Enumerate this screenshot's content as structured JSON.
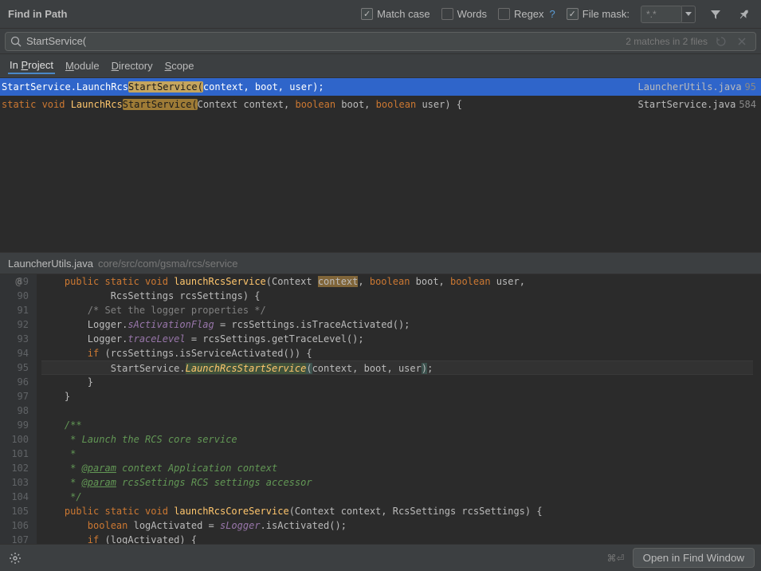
{
  "header": {
    "title": "Find in Path",
    "match_case_label": "Match case",
    "match_case_checked": true,
    "words_label": "Words",
    "words_checked": false,
    "regex_label": "Regex",
    "regex_checked": false,
    "regex_help": "?",
    "file_mask_label": "File mask:",
    "file_mask_checked": true,
    "file_mask_value": "*.*"
  },
  "search": {
    "value": "StartService(",
    "status": "2 matches in 2 files"
  },
  "scope_tabs": {
    "in_project": "In Project",
    "module": "Module",
    "directory": "Directory",
    "scope": "Scope"
  },
  "results": [
    {
      "prefix": "StartService.LaunchRcs",
      "highlight": "StartService(",
      "suffix": "context, boot, user);",
      "file": "LauncherUtils.java",
      "line": "95",
      "selected": true
    },
    {
      "mod": "static void ",
      "prefix": "LaunchRcs",
      "highlight": "StartService(",
      "sig_part1": "Context context, ",
      "kw1": "boolean",
      "sig_part2": " boot, ",
      "kw2": "boolean",
      "sig_part3": " user) {",
      "file": "StartService.java",
      "line": "584",
      "selected": false
    }
  ],
  "preview": {
    "filename": "LauncherUtils.java",
    "path": "core/src/com/gsma/rcs/service",
    "gutter_mark": "@",
    "lines": [
      {
        "n": "89",
        "html": "    <span class='c-keyword'>public static void </span><span class='c-method'>launchRcsService</span>(Context <span class='c-hl-bg'>context</span>, <span class='c-keyword'>boolean</span> boot, <span class='c-keyword'>boolean</span> user,"
      },
      {
        "n": "90",
        "html": "            RcsSettings rcsSettings) {"
      },
      {
        "n": "91",
        "html": "        <span class='c-comment'>/* Set the logger properties */</span>"
      },
      {
        "n": "92",
        "html": "        Logger.<span class='c-field'>sActivationFlag</span> = rcsSettings.isTraceActivated();"
      },
      {
        "n": "93",
        "html": "        Logger.<span class='c-field'>traceLevel</span> = rcsSettings.getTraceLevel();"
      },
      {
        "n": "94",
        "html": "        <span class='c-keyword'>if</span> (rcsSettings.isServiceActivated()) {"
      },
      {
        "n": "95",
        "html": "            StartService.<span class='c-hl-method'>LaunchRcsStartService</span><span class='c-paren-match'>(</span>context, boot, user<span class='c-paren-match'>)</span>;",
        "current": true
      },
      {
        "n": "96",
        "html": "        }"
      },
      {
        "n": "97",
        "html": "    }"
      },
      {
        "n": "98",
        "html": ""
      },
      {
        "n": "99",
        "html": "    <span class='c-doc'>/**</span>"
      },
      {
        "n": "100",
        "html": "<span class='c-doc'>     * Launch the RCS core service</span>"
      },
      {
        "n": "101",
        "html": "<span class='c-doc'>     *</span>"
      },
      {
        "n": "102",
        "html": "<span class='c-doc'>     * <span class='c-doctag'>@param</span> context Application context</span>"
      },
      {
        "n": "103",
        "html": "<span class='c-doc'>     * <span class='c-doctag'>@param</span> rcsSettings RCS settings accessor</span>"
      },
      {
        "n": "104",
        "html": "<span class='c-doc'>     */</span>"
      },
      {
        "n": "105",
        "html": "    <span class='c-keyword'>public static void </span><span class='c-method'>launchRcsCoreService</span>(Context context, RcsSettings rcsSettings) {"
      },
      {
        "n": "106",
        "html": "        <span class='c-keyword'>boolean</span> logActivated = <span class='c-field'>sLogger</span>.isActivated();"
      },
      {
        "n": "107",
        "html": "        <span class='c-keyword'>if</span> (logActivated) {"
      }
    ]
  },
  "footer": {
    "shortcut": "⌘⏎",
    "open_button": "Open in Find Window"
  }
}
